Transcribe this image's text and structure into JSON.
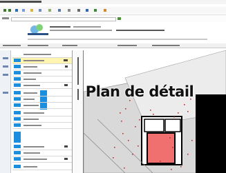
{
  "map": {
    "title": "Plan de détail",
    "colors": {
      "highlight": "#f07070",
      "points": "#e02020",
      "building": "#000000",
      "land": "#d9d9d9"
    }
  },
  "icons": [
    "back-icon",
    "forward-icon",
    "refresh-icon",
    "home-icon",
    "favorites-icon"
  ]
}
